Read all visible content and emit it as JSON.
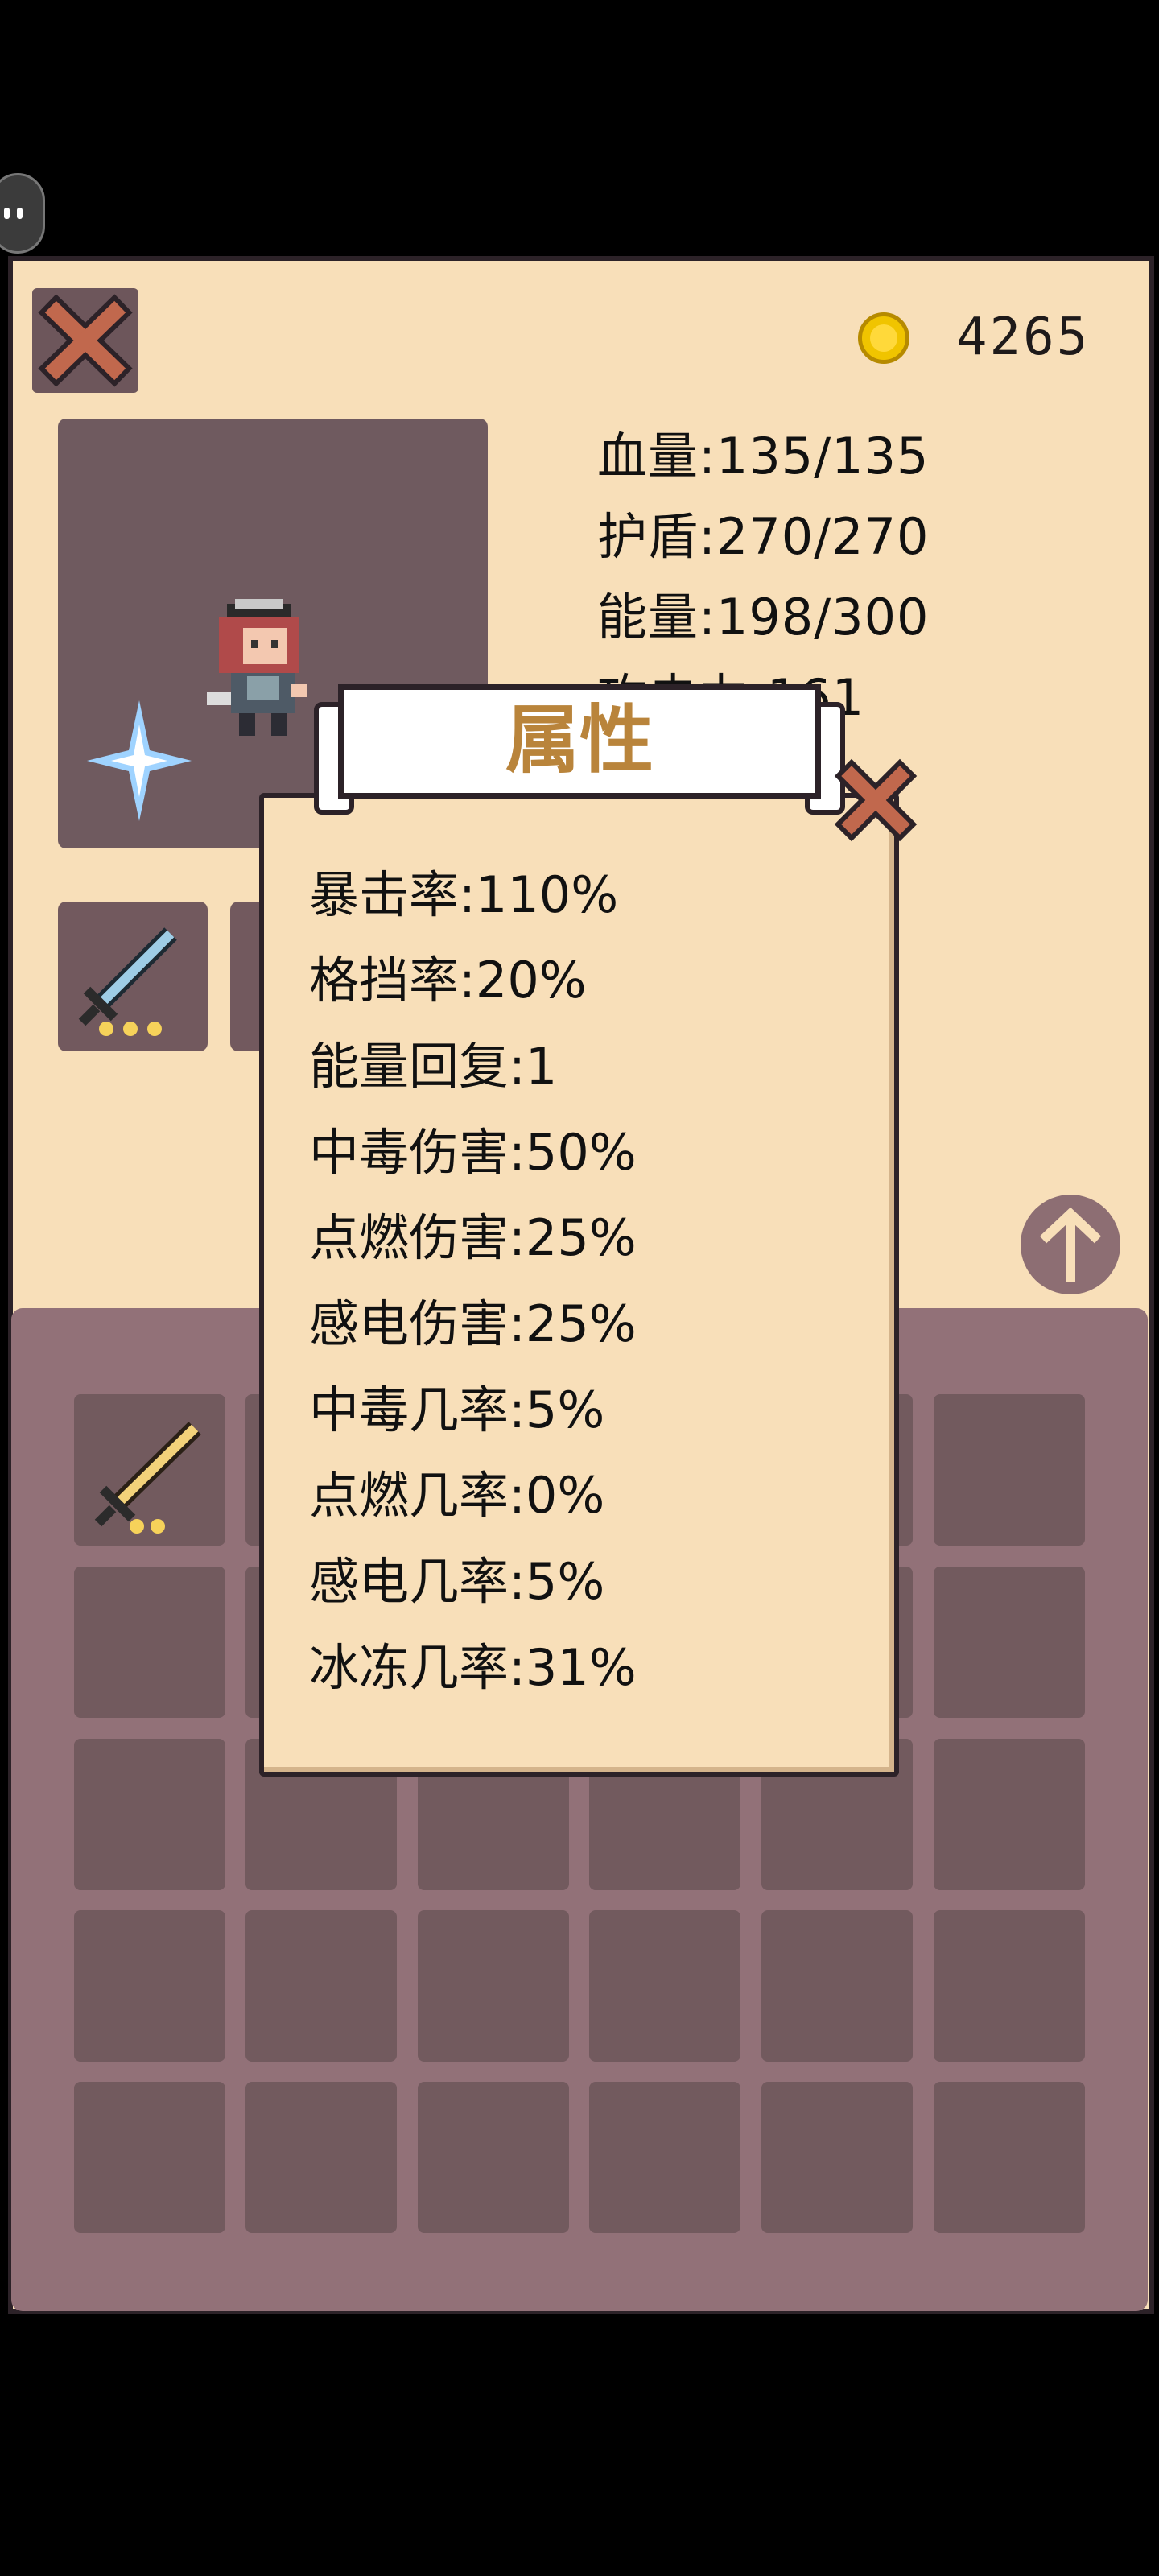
{
  "header": {
    "coins": "4265"
  },
  "stats": [
    "血量:135/135",
    "护盾:270/270",
    "能量:198/300",
    "攻击力:161"
  ],
  "popup": {
    "title": "属性",
    "lines": [
      "暴击率:110%",
      "格挡率:20%",
      "能量回复:1",
      "中毒伤害:50%",
      "点燃伤害:25%",
      "感电伤害:25%",
      "中毒几率:5%",
      "点燃几率:0%",
      "感电几率:5%",
      "冰冻几率:31%"
    ]
  },
  "icons": {
    "close": "close-x-icon",
    "coin": "gold-coin-icon",
    "equip_weapon": "silver-sword-icon",
    "inventory_weapon": "gold-sword-icon",
    "upgrade": "arrow-up-icon"
  },
  "colors": {
    "panel_bg": "#f8dfb9",
    "slot_bg": "#72595e",
    "title_gold": "#b9843b"
  }
}
